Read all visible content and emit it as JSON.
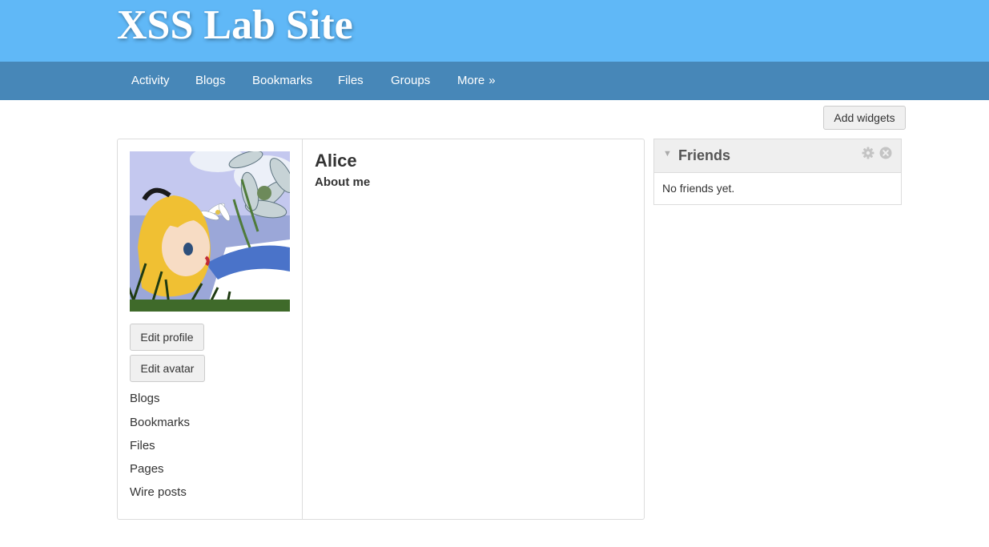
{
  "site": {
    "title": "XSS Lab Site"
  },
  "nav": {
    "items": [
      {
        "label": "Activity"
      },
      {
        "label": "Blogs"
      },
      {
        "label": "Bookmarks"
      },
      {
        "label": "Files"
      },
      {
        "label": "Groups"
      },
      {
        "label": "More",
        "suffix": "»"
      }
    ]
  },
  "toolbar": {
    "add_widgets_label": "Add widgets"
  },
  "profile": {
    "name": "Alice",
    "about_label": "About me",
    "avatar_icon": "alice-avatar-image",
    "edit_profile_label": "Edit profile",
    "edit_avatar_label": "Edit avatar",
    "links": [
      {
        "label": "Blogs"
      },
      {
        "label": "Bookmarks"
      },
      {
        "label": "Files"
      },
      {
        "label": "Pages"
      },
      {
        "label": "Wire posts"
      }
    ]
  },
  "friends_widget": {
    "title": "Friends",
    "empty_text": "No friends yet.",
    "collapse_icon": "triangle-down-icon",
    "settings_icon": "gear-icon",
    "close_icon": "close-circle-icon"
  },
  "colors": {
    "topbar": "#60b8f7",
    "navbar": "#4787b8",
    "widget_header": "#efefef"
  }
}
